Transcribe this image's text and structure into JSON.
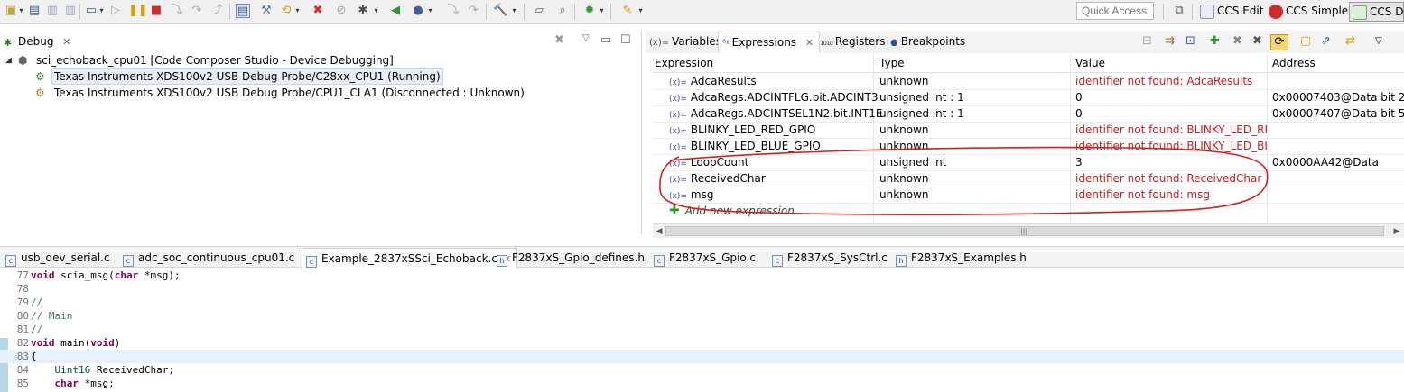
{
  "toolbar": {
    "quick_access_placeholder": "Quick Access",
    "perspectives": [
      {
        "label": "CCS Edit",
        "icon": "ccs-edit-icon"
      },
      {
        "label": "CCS Simple",
        "icon": "ccs-simple-icon",
        "color": "#d22b2b"
      },
      {
        "label": "CCS De",
        "icon": "ccs-debug-icon"
      }
    ]
  },
  "debug_view": {
    "tab_label": "Debug",
    "tree": [
      {
        "label": "sci_echoback_cpu01 [Code Composer Studio - Device Debugging]",
        "icon": "project-cube-icon"
      },
      {
        "label": "Texas Instruments XDS100v2 USB Debug Probe/C28xx_CPU1 (Running)",
        "icon": "target-running-icon",
        "selected": true
      },
      {
        "label": "Texas Instruments XDS100v2 USB Debug Probe/CPU1_CLA1 (Disconnected : Unknown)",
        "icon": "target-disconnected-icon"
      }
    ]
  },
  "expressions_view": {
    "tabs": [
      {
        "label": "Variables",
        "prefix": "(x)="
      },
      {
        "label": "Expressions",
        "prefix": "6",
        "active": true
      },
      {
        "label": "Registers",
        "prefix": "1010"
      },
      {
        "label": "Breakpoints",
        "prefix": "●"
      }
    ],
    "columns": [
      "Expression",
      "Type",
      "Value",
      "Address"
    ],
    "rows": [
      {
        "expression": "AdcaResults",
        "type": "unknown",
        "value": "identifier not found: AdcaResults",
        "address": "",
        "error": true
      },
      {
        "expression": "AdcaRegs.ADCINTFLG.bit.ADCINT3",
        "type": "unsigned int : 1",
        "value": "0",
        "address": "0x00007403@Data bit 2",
        "error": false
      },
      {
        "expression": "AdcaRegs.ADCINTSEL1N2.bit.INT1E",
        "type": "unsigned int : 1",
        "value": "0",
        "address": "0x00007407@Data bit 5",
        "error": false
      },
      {
        "expression": "BLINKY_LED_RED_GPIO",
        "type": "unknown",
        "value": "identifier not found: BLINKY_LED_RED...",
        "address": "",
        "error": true
      },
      {
        "expression": "BLINKY_LED_BLUE_GPIO",
        "type": "unknown",
        "value": "identifier not found: BLINKY_LED_BLU...",
        "address": "",
        "error": true
      },
      {
        "expression": "LoopCount",
        "type": "unsigned int",
        "value": "3",
        "address": "0x0000AA42@Data",
        "error": false
      },
      {
        "expression": "ReceivedChar",
        "type": "unknown",
        "value": "identifier not found: ReceivedChar",
        "address": "",
        "error": true
      },
      {
        "expression": "msg",
        "type": "unknown",
        "value": "identifier not found: msg",
        "address": "",
        "error": true
      }
    ],
    "var_badge": "(x)=",
    "add_new_label": "Add new expression",
    "annotation_color": "#d61f1f"
  },
  "editor_tabs": [
    {
      "label": "usb_dev_serial.c",
      "kind": "c"
    },
    {
      "label": "adc_soc_continuous_cpu01.c",
      "kind": "c"
    },
    {
      "label": "Example_2837xSSci_Echoback.c",
      "kind": "c",
      "active": true
    },
    {
      "label": "F2837xS_Gpio_defines.h",
      "kind": "h"
    },
    {
      "label": "F2837xS_Gpio.c",
      "kind": "c"
    },
    {
      "label": "F2837xS_SysCtrl.c",
      "kind": "c"
    },
    {
      "label": "F2837xS_Examples.h",
      "kind": "h"
    }
  ],
  "code": [
    {
      "n": "77",
      "text": "void scia_msg(char *msg);"
    },
    {
      "n": "78",
      "text": ""
    },
    {
      "n": "79",
      "text": "//"
    },
    {
      "n": "80",
      "text": "// Main"
    },
    {
      "n": "81",
      "text": "//"
    },
    {
      "n": "82",
      "text": "void main(void)"
    },
    {
      "n": "83",
      "text": "{"
    },
    {
      "n": "84",
      "text": "    Uint16 ReceivedChar;"
    },
    {
      "n": "85",
      "text": "    char *msg;"
    }
  ]
}
